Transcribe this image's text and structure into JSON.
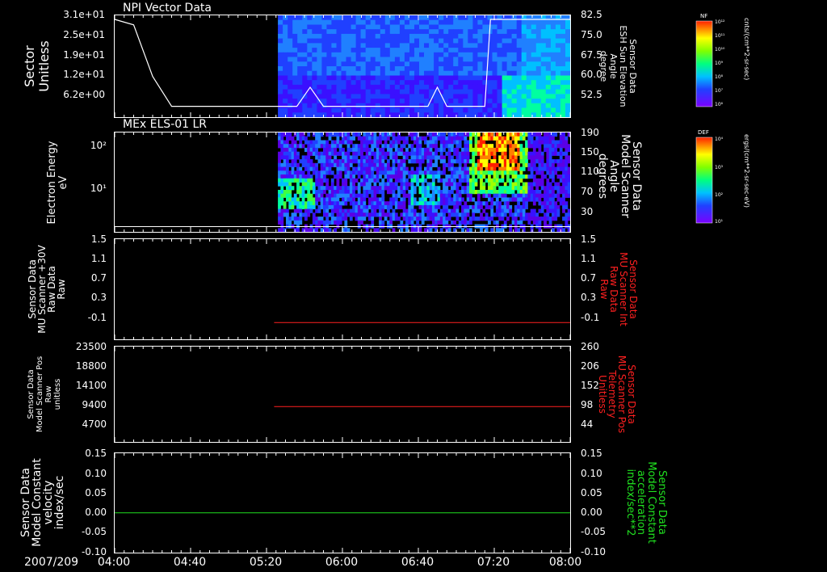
{
  "colors": {
    "background": "#000000",
    "axis": "#ffffff",
    "red": "#ff2020",
    "green": "#20e020"
  },
  "date_label": "2007/209",
  "time_ticks": [
    "04:00",
    "04:40",
    "05:20",
    "06:00",
    "06:40",
    "07:20",
    "08:00"
  ],
  "colorbars": [
    {
      "title": "NF",
      "max_label": "10¹²",
      "labels": [
        "10¹²",
        "10¹¹",
        "10¹⁰",
        "10⁹",
        "10⁸",
        "10⁷",
        "10⁶"
      ],
      "unit": "cnts/(cm**2-sr-sec)"
    },
    {
      "title": "DEF",
      "max_label": "10⁴",
      "labels": [
        "10⁴",
        "10³",
        "10²",
        "10¹"
      ],
      "unit": "ergs/(cm**2-sr-sec-eV)"
    }
  ],
  "chart_data": [
    {
      "type": "heatmap",
      "title": "NPI Vector Data",
      "ylabel": "Sector",
      "yunit": "Unitless",
      "yticks": [
        "3.1e+01",
        "2.5e+01",
        "1.9e+01",
        "1.2e+01",
        "6.2e+00"
      ],
      "y2label": [
        "Sensor Data",
        "ESH Sun Elevation",
        "Angle",
        "degree"
      ],
      "y2ticks": [
        "82.5",
        "75.0",
        "67.5",
        "60.0",
        "52.5"
      ],
      "y2lim": [
        45,
        82.5
      ],
      "data_start": "05:26",
      "line": {
        "color": "#ffffff",
        "x": [
          "04:00",
          "04:10",
          "04:20",
          "04:30",
          "05:30",
          "05:36",
          "05:43",
          "05:50",
          "06:40",
          "06:45",
          "06:50",
          "06:55",
          "07:10",
          "07:15",
          "07:18",
          "08:00"
        ],
        "y": [
          81,
          79,
          60,
          49,
          49,
          49,
          56,
          49,
          49,
          49,
          56,
          49,
          49,
          49,
          81,
          81
        ]
      }
    },
    {
      "type": "heatmap",
      "title": "MEx ELS-01 LR",
      "ylabel": "Electron Energy",
      "yunit": "eV",
      "yticks": [
        "10²",
        "10¹"
      ],
      "y2label": [
        "Sensor Data",
        "Model Scanner",
        "Angle",
        "degrees"
      ],
      "y2ticks": [
        "190",
        "150",
        "110",
        "70",
        "30"
      ],
      "y2lim": [
        0,
        190
      ],
      "data_start": "05:26",
      "line": {
        "color": "#ffffff",
        "x": [
          "04:00",
          "08:00"
        ],
        "y": [
          10,
          10
        ]
      }
    },
    {
      "type": "line",
      "ylabel": [
        "Sensor Data",
        "MU Scanner +30V",
        "Raw Data",
        "Raw"
      ],
      "yticks": [
        "1.5",
        "1.1",
        "0.7",
        "0.3",
        "-0.1"
      ],
      "ylim": [
        -0.3,
        1.5
      ],
      "y2label": [
        "Sensor Data",
        "MU Scanner Int",
        "Raw Data",
        "Raw"
      ],
      "y2ticks": [
        "1.5",
        "1.1",
        "0.7",
        "0.3",
        "-0.1"
      ],
      "series": [
        {
          "color": "#ff2020",
          "x": [
            "05:24",
            "08:00"
          ],
          "y": [
            0,
            0
          ]
        }
      ]
    },
    {
      "type": "line",
      "ylabel": [
        "Sensor Data",
        "Model Scanner Pos",
        "Raw",
        "unitless"
      ],
      "yticks": [
        "23500",
        "18800",
        "14100",
        "9400",
        "4700"
      ],
      "ylim": [
        0,
        23500
      ],
      "y2label": [
        "Sensor Data",
        "MU Scanner Pos",
        "Telemetry",
        "Unitless"
      ],
      "y2ticks": [
        "260",
        "206",
        "152",
        "98",
        "44"
      ],
      "y2lim": [
        -10,
        260
      ],
      "series": [
        {
          "color": "#ff2020",
          "x": [
            "05:24",
            "08:00"
          ],
          "y": [
            90,
            90
          ]
        }
      ]
    },
    {
      "type": "line",
      "ylabel": [
        "Sensor Data",
        "Model Constant",
        "velocity",
        "index/sec"
      ],
      "yticks": [
        "0.15",
        "0.10",
        "0.05",
        "0.00",
        "-0.05",
        "-0.10"
      ],
      "ylim": [
        -0.1,
        0.15
      ],
      "y2label": [
        "Sensor Data",
        "Model Constant",
        "acceleration",
        "index/sec**2"
      ],
      "y2ticks": [
        "0.15",
        "0.10",
        "0.05",
        "0.00",
        "-0.05",
        "-0.10"
      ],
      "series": [
        {
          "color": "#20e020",
          "x": [
            "04:00",
            "08:00"
          ],
          "y": [
            0,
            0
          ]
        }
      ]
    }
  ]
}
